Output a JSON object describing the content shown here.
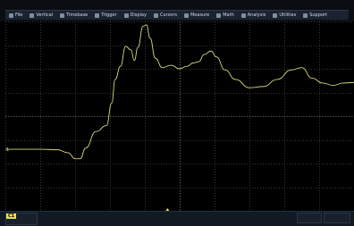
{
  "menu": [
    {
      "label": "File",
      "icon": "file-icon"
    },
    {
      "label": "Vertical",
      "icon": "vertical-icon"
    },
    {
      "label": "Timebase",
      "icon": "timebase-icon"
    },
    {
      "label": "Trigger",
      "icon": "trigger-icon"
    },
    {
      "label": "Display",
      "icon": "display-icon"
    },
    {
      "label": "Cursors",
      "icon": "cursors-icon"
    },
    {
      "label": "Measure",
      "icon": "measure-icon"
    },
    {
      "label": "Math",
      "icon": "math-icon"
    },
    {
      "label": "Analysis",
      "icon": "analysis-icon"
    },
    {
      "label": "Utilities",
      "icon": "utilities-icon"
    },
    {
      "label": "Support",
      "icon": "support-icon"
    }
  ],
  "channel": {
    "name": "C1",
    "color": "#e9e04a",
    "marker_label": "1"
  },
  "colors": {
    "trace": "#d7d57a",
    "grid": "#6b6b6b",
    "background": "#000000"
  },
  "chart_data": {
    "type": "line",
    "grid": {
      "divisions_x": 10,
      "divisions_y": 8,
      "on": true
    },
    "x_range": [
      0,
      10
    ],
    "y_range": [
      -4,
      4
    ],
    "series": [
      {
        "points": [
          [
            0.0,
            -1.4
          ],
          [
            1.0,
            -1.4
          ],
          [
            1.5,
            -1.42
          ],
          [
            1.8,
            -1.55
          ],
          [
            2.0,
            -1.8
          ],
          [
            2.15,
            -1.8
          ],
          [
            2.3,
            -1.35
          ],
          [
            2.6,
            -0.65
          ],
          [
            2.9,
            -0.4
          ],
          [
            3.05,
            0.55
          ],
          [
            3.15,
            1.55
          ],
          [
            3.3,
            2.1
          ],
          [
            3.45,
            2.95
          ],
          [
            3.6,
            2.8
          ],
          [
            3.7,
            2.35
          ],
          [
            3.8,
            2.9
          ],
          [
            3.95,
            3.8
          ],
          [
            4.05,
            3.85
          ],
          [
            4.15,
            3.3
          ],
          [
            4.3,
            2.45
          ],
          [
            4.5,
            2.05
          ],
          [
            4.75,
            2.15
          ],
          [
            5.0,
            2.0
          ],
          [
            5.2,
            2.1
          ],
          [
            5.4,
            2.25
          ],
          [
            5.55,
            2.3
          ],
          [
            5.7,
            2.6
          ],
          [
            5.9,
            2.75
          ],
          [
            6.05,
            2.5
          ],
          [
            6.3,
            1.95
          ],
          [
            6.6,
            1.55
          ],
          [
            7.0,
            1.2
          ],
          [
            7.4,
            1.25
          ],
          [
            7.8,
            1.55
          ],
          [
            8.2,
            1.95
          ],
          [
            8.5,
            2.05
          ],
          [
            8.8,
            1.6
          ],
          [
            9.1,
            1.4
          ],
          [
            9.4,
            1.3
          ],
          [
            9.7,
            1.4
          ],
          [
            10.0,
            1.42
          ]
        ]
      }
    ]
  }
}
